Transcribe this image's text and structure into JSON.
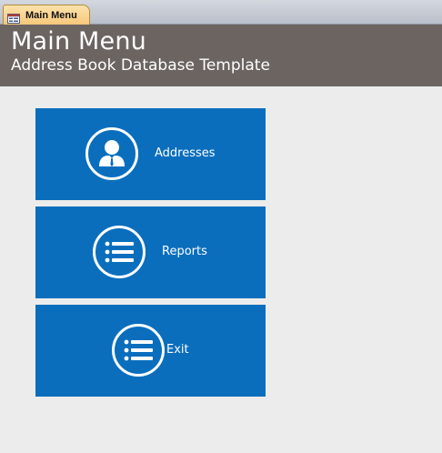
{
  "tab": {
    "label": "Main Menu"
  },
  "header": {
    "title": "Main Menu",
    "subtitle": "Address Book Database Template"
  },
  "buttons": {
    "addresses": {
      "label": "Addresses",
      "icon": "person-icon"
    },
    "reports": {
      "label": "Reports",
      "icon": "list-icon"
    },
    "exit": {
      "label": "Exit",
      "icon": "list-icon"
    }
  },
  "colors": {
    "header_bg": "#6b6461",
    "button_bg": "#0a6ebd",
    "page_bg": "#ececec",
    "tab_bg": "#f6c77b"
  }
}
